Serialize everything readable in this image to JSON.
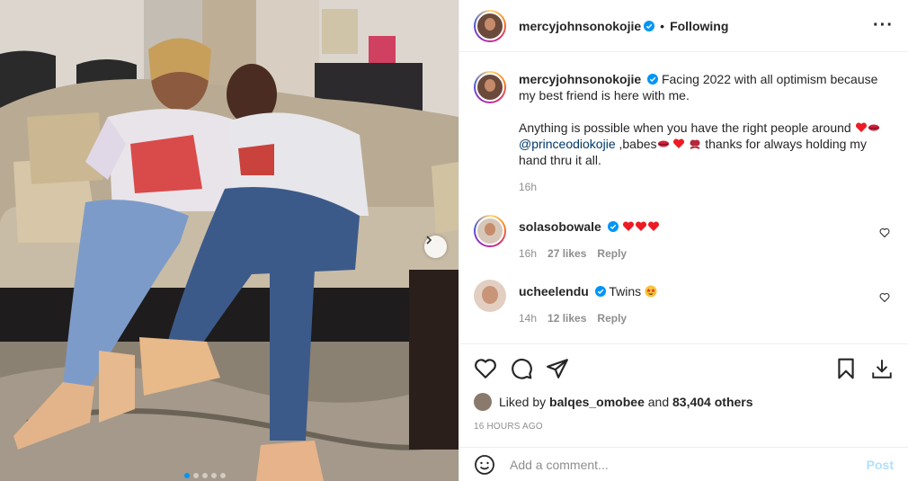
{
  "post": {
    "author": "mercyjohnsonokojie",
    "follow_status": "Following",
    "more_icon": "more-horizontal-icon",
    "carousel": {
      "dot_count": 5,
      "active_index": 0
    }
  },
  "caption": {
    "username": "mercyjohnsonokojie",
    "line1": "Facing 2022 with all optimism because my best friend is here with me.",
    "line2a": "Anything is possible when you have the right people around",
    "mention": "@princeodiokojie",
    "line2b": ",babes",
    "line2c": "thanks for always holding my hand thru it all.",
    "time": "16h"
  },
  "comments": [
    {
      "username": "solasobowale",
      "verified": true,
      "text": "",
      "hearts": 3,
      "time": "16h",
      "likes": "27 likes",
      "reply": "Reply"
    },
    {
      "username": "ucheelendu",
      "verified": true,
      "text": "Twins",
      "emoji": "star-struck",
      "time": "14h",
      "likes": "12 likes",
      "reply": "Reply"
    }
  ],
  "actions": {
    "liked_by_prefix": "Liked by",
    "liked_by_user": "balqes_omobee",
    "liked_by_and": "and",
    "liked_by_count": "83,404 others",
    "posted_ago": "16 HOURS AGO"
  },
  "composer": {
    "placeholder": "Add a comment...",
    "post_label": "Post"
  },
  "colors": {
    "verified_blue": "#0095f6",
    "heart_red": "#ed1b24",
    "mention_blue": "#00376b",
    "post_disabled": "#b2dffc",
    "muted": "#8e8e8e"
  }
}
